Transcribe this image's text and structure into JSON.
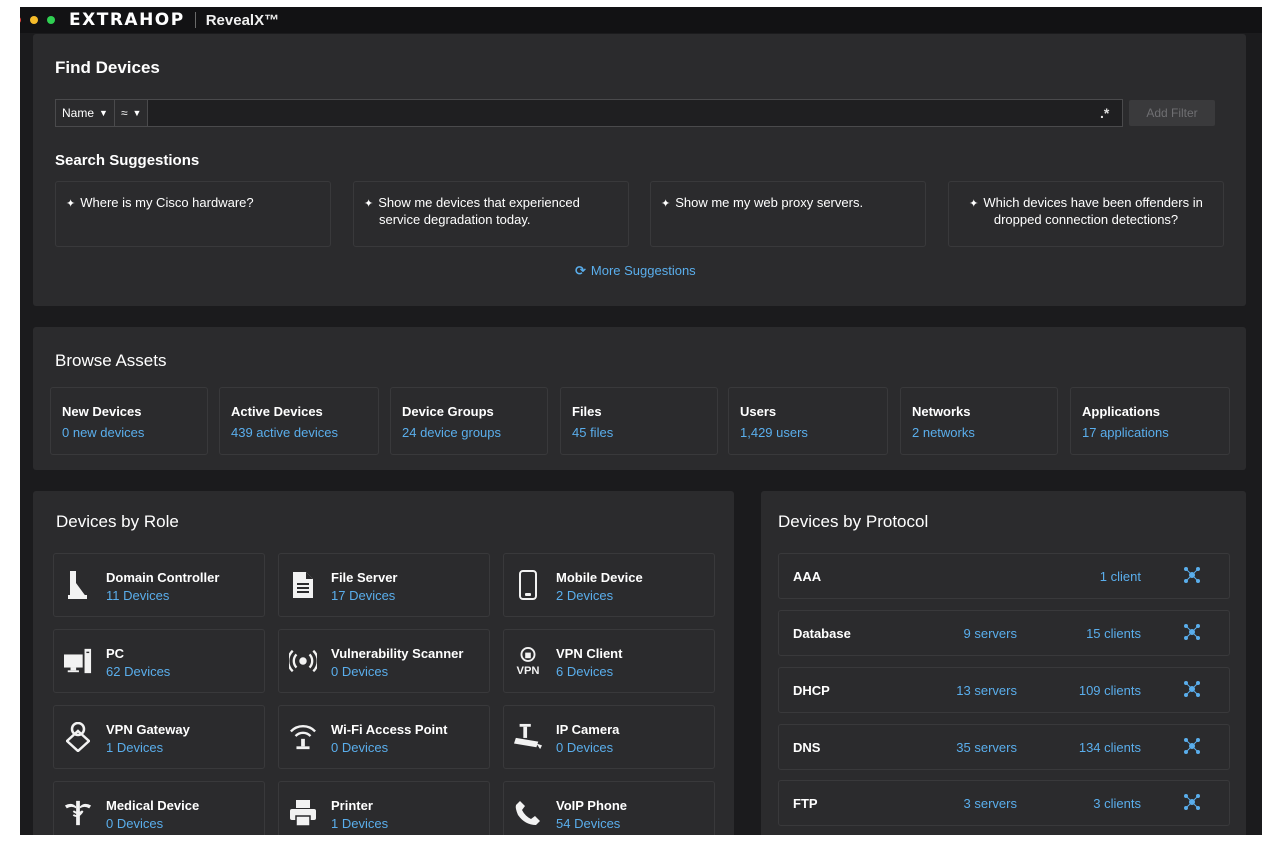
{
  "titlebar": {
    "brand": "EXTRAHOP",
    "product": "RevealX™"
  },
  "find_devices": {
    "title": "Find Devices",
    "field_select": "Name",
    "operator_select": "≈",
    "filter_value": "",
    "regex_label": ".*",
    "add_filter_label": "Add Filter",
    "suggestions_title": "Search Suggestions",
    "suggestions": [
      {
        "line1": "Where is my Cisco hardware?",
        "line2": ""
      },
      {
        "line1": "Show me devices that experienced",
        "line2": "service degradation today."
      },
      {
        "line1": "Show me my web proxy servers.",
        "line2": ""
      },
      {
        "line1": "Which devices have been offenders in",
        "line2": "dropped connection detections?"
      }
    ],
    "more_suggestions": "More Suggestions"
  },
  "browse_assets": {
    "title": "Browse Assets",
    "items": [
      {
        "title": "New Devices",
        "link": "0 new devices"
      },
      {
        "title": "Active Devices",
        "link": "439 active devices"
      },
      {
        "title": "Device Groups",
        "link": "24 device groups"
      },
      {
        "title": "Files",
        "link": "45 files"
      },
      {
        "title": "Users",
        "link": "1,429 users"
      },
      {
        "title": "Networks",
        "link": "2 networks"
      },
      {
        "title": "Applications",
        "link": "17 applications"
      }
    ]
  },
  "devices_by_role": {
    "title": "Devices by Role",
    "roles": [
      {
        "name": "Domain Controller",
        "count": "11 Devices",
        "icon": "domain-controller-icon"
      },
      {
        "name": "File Server",
        "count": "17 Devices",
        "icon": "file-server-icon"
      },
      {
        "name": "Mobile Device",
        "count": "2 Devices",
        "icon": "mobile-device-icon"
      },
      {
        "name": "PC",
        "count": "62 Devices",
        "icon": "pc-icon"
      },
      {
        "name": "Vulnerability Scanner",
        "count": "0 Devices",
        "icon": "vulnerability-scanner-icon"
      },
      {
        "name": "VPN Client",
        "count": "6 Devices",
        "icon": "vpn-client-icon"
      },
      {
        "name": "VPN Gateway",
        "count": "1 Devices",
        "icon": "vpn-gateway-icon"
      },
      {
        "name": "Wi-Fi Access Point",
        "count": "0 Devices",
        "icon": "wifi-access-point-icon"
      },
      {
        "name": "IP Camera",
        "count": "0 Devices",
        "icon": "ip-camera-icon"
      },
      {
        "name": "Medical Device",
        "count": "0 Devices",
        "icon": "medical-device-icon"
      },
      {
        "name": "Printer",
        "count": "1 Devices",
        "icon": "printer-icon"
      },
      {
        "name": "VoIP Phone",
        "count": "54 Devices",
        "icon": "voip-phone-icon"
      }
    ]
  },
  "devices_by_protocol": {
    "title": "Devices by Protocol",
    "protocols": [
      {
        "name": "AAA",
        "servers": "",
        "clients": "1 client"
      },
      {
        "name": "Database",
        "servers": "9 servers",
        "clients": "15 clients"
      },
      {
        "name": "DHCP",
        "servers": "13 servers",
        "clients": "109 clients"
      },
      {
        "name": "DNS",
        "servers": "35 servers",
        "clients": "134 clients"
      },
      {
        "name": "FTP",
        "servers": "3 servers",
        "clients": "3 clients"
      }
    ]
  },
  "colors": {
    "background": "#1b1b1d",
    "panel": "#2b2b2d",
    "link": "#5aaeec",
    "network_icon": "#5aaeec"
  }
}
